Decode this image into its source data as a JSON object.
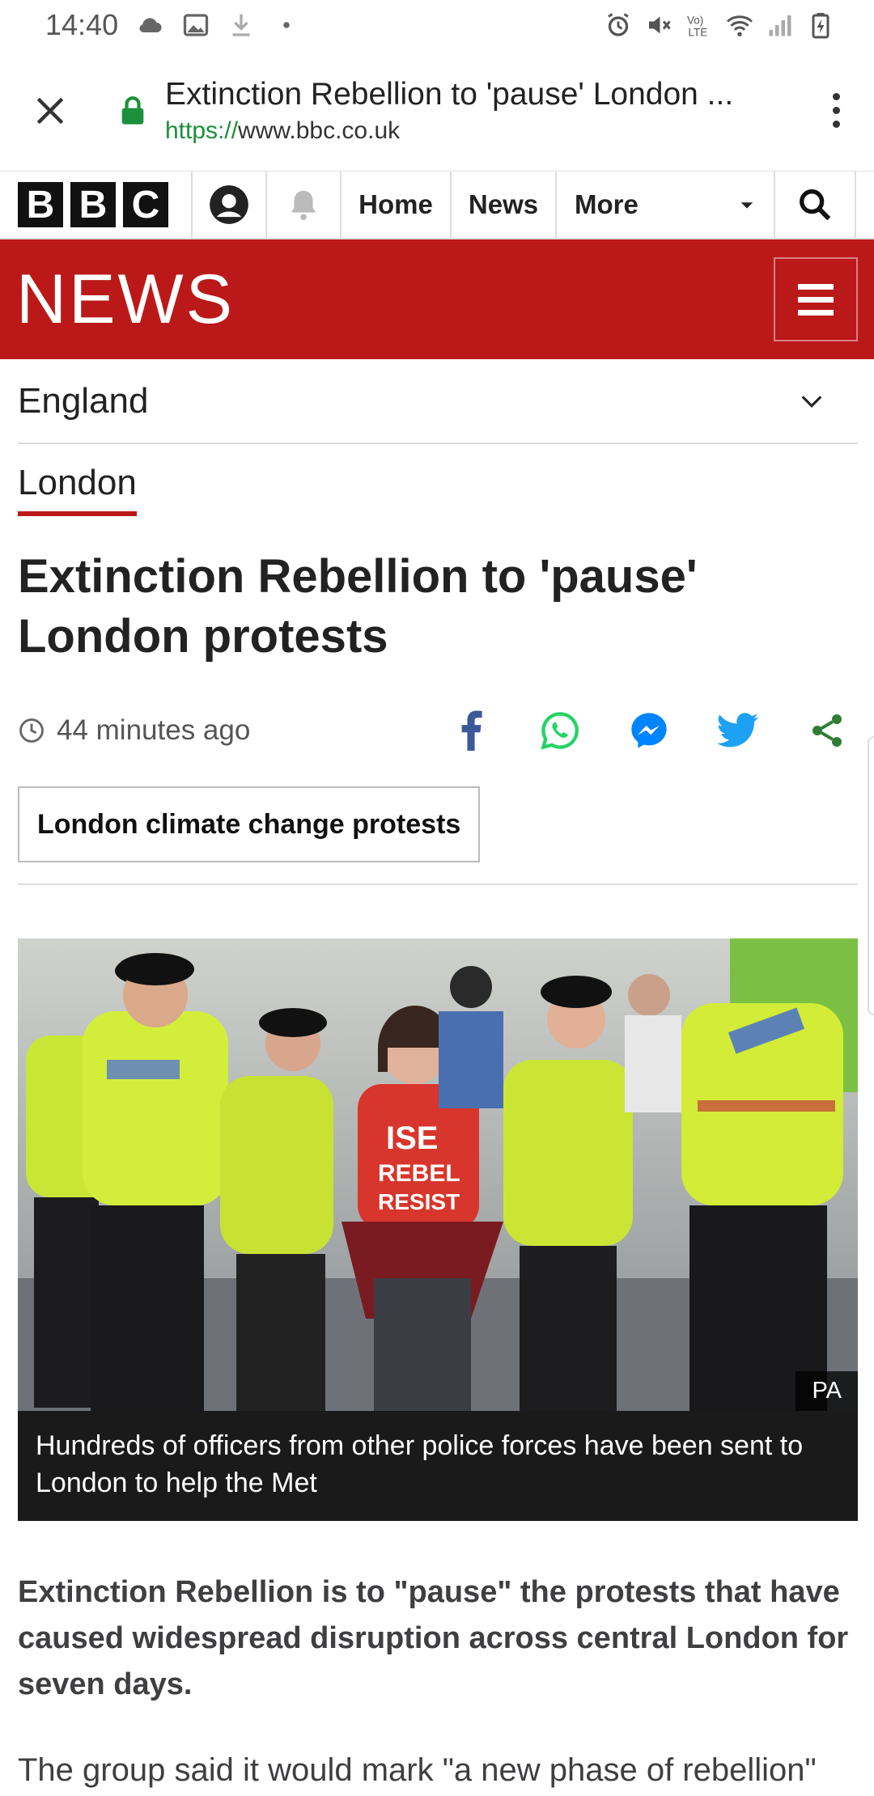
{
  "status_bar": {
    "time": "14:40"
  },
  "browser": {
    "page_title": "Extinction Rebellion to 'pause' London ...",
    "url_scheme": "https://",
    "url_host": "www.bbc.co.uk"
  },
  "bbc_nav": {
    "logo_letters": [
      "B",
      "B",
      "C"
    ],
    "home_label": "Home",
    "news_label": "News",
    "more_label": "More"
  },
  "banner": {
    "title": "NEWS"
  },
  "region": {
    "label": "England"
  },
  "subsection": {
    "label": "London"
  },
  "article": {
    "headline": "Extinction Rebellion to 'pause' London protests",
    "timestamp": "44 minutes ago",
    "topic_tag": "London climate change protests",
    "image_credit": "PA",
    "image_caption": "Hundreds of officers from other police forces have been sent to London to help the Met",
    "intro": "Extinction Rebellion is to \"pause\" the protests that have caused widespread disruption across central London for seven days.",
    "body_first_line": "The group said it would mark \"a new phase of rebellion\""
  },
  "colors": {
    "bbc_red": "#bb1919",
    "secure_green": "#1a8f3c",
    "facebook": "#3b5998",
    "whatsapp": "#25d366",
    "messenger": "#0084ff",
    "twitter": "#1da1f2",
    "share": "#2e7d32"
  }
}
